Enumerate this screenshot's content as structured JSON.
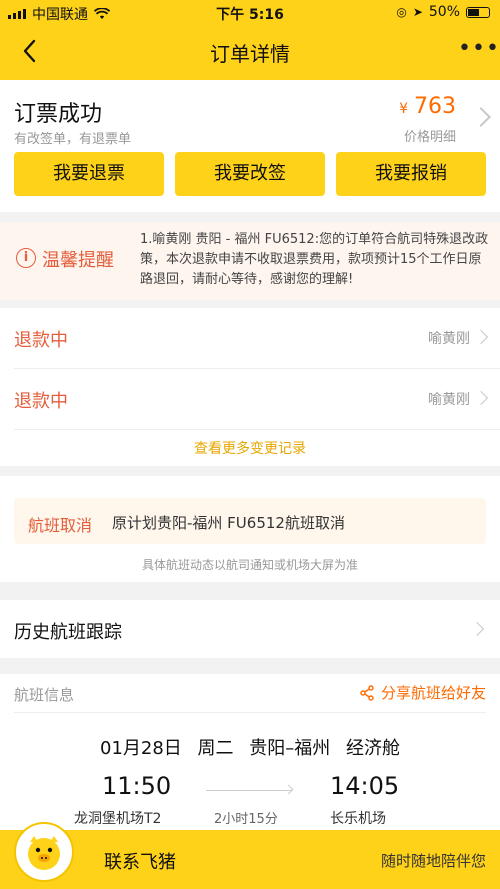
{
  "status": {
    "carrier": "中国联通",
    "time": "下午 5:16",
    "battery": "50%",
    "battery_level": 0.5
  },
  "nav": {
    "title": "订单详情",
    "back_icon": "chevron-left-icon",
    "more_label": "•••"
  },
  "order": {
    "status": "订票成功",
    "sub": "有改签单，有退票单",
    "currency": "¥",
    "price": "763",
    "price_detail": "价格明细",
    "buttons": [
      "我要退票",
      "我要改签",
      "我要报销"
    ]
  },
  "reminder": {
    "title": "温馨提醒",
    "text": "1.喻黄刚 贵阳 - 福州 FU6512:您的订单符合航司特殊退改政策，本次退款申请不收取退票费用，款项预计15个工作日原路退回，请耐心等待，感谢您的理解!"
  },
  "refunds": [
    {
      "label": "退款中",
      "name": "喻黄刚"
    },
    {
      "label": "退款中",
      "name": "喻黄刚"
    }
  ],
  "more_records": "查看更多变更记录",
  "cancel": {
    "tag": "航班取消",
    "text": "原计划贵阳-福州 FU6512航班取消",
    "note": "具体航班动态以航司通知或机场大屏为准"
  },
  "history": {
    "title": "历史航班跟踪"
  },
  "flight": {
    "section_title": "航班信息",
    "share": "分享航班给好友",
    "route": "01月28日 周二 贵阳–福州 经济舱",
    "dep_time": "11:50",
    "arr_time": "14:05",
    "dep_airport": "龙洞堡机场T2",
    "arr_airport": "长乐机场",
    "duration": "2小时15分"
  },
  "bottom": {
    "contact": "联系飞猪",
    "anytime": "随时随地陪伴您"
  },
  "colors": {
    "brand_yellow": "#ffd21a",
    "accent_orange": "#ff6a00",
    "alert_red": "#e35e3c"
  }
}
